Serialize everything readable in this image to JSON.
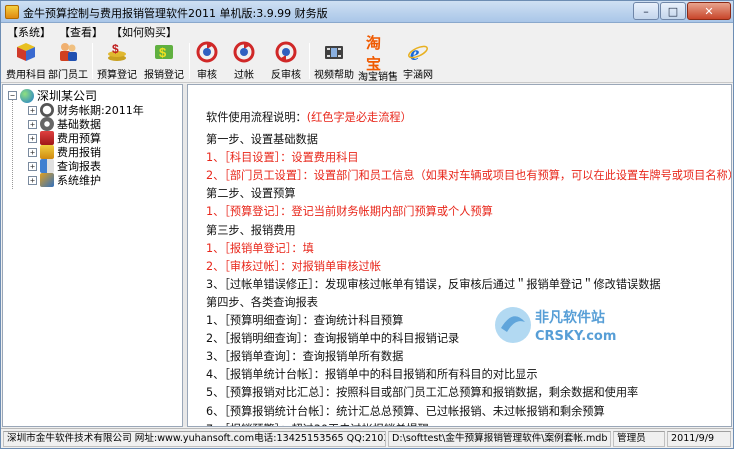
{
  "window": {
    "title": "金牛预算控制与费用报销管理软件2011 单机版:3.9.99 财务版",
    "min_glyph": "–",
    "max_glyph": "□",
    "close_glyph": "✕"
  },
  "menu": [
    "【系统】",
    "【查看】",
    "【如何购买】"
  ],
  "toolbar": [
    {
      "label": "费用科目",
      "icon": "cube-icon"
    },
    {
      "label": "部门员工",
      "icon": "people-icon"
    },
    {
      "label": "预算登记",
      "icon": "money-icon"
    },
    {
      "label": "报销登记",
      "icon": "dollar-icon"
    },
    {
      "label": "审核",
      "icon": "review-icon"
    },
    {
      "label": "过帐",
      "icon": "post-icon"
    },
    {
      "label": "反审核",
      "icon": "unreview-icon"
    },
    {
      "label": "视频帮助",
      "icon": "video-icon"
    },
    {
      "label": "淘宝销售",
      "icon": "taobao-icon"
    },
    {
      "label": "宇涵网",
      "icon": "ie-icon"
    }
  ],
  "taobao_text": "淘宝",
  "tree": {
    "root": "深圳某公司",
    "children": [
      {
        "label": "财务帐期:2011年",
        "expand": "+"
      },
      {
        "label": "基础数据",
        "expand": "+"
      },
      {
        "label": "费用预算",
        "expand": "+"
      },
      {
        "label": "费用报销",
        "expand": "+"
      },
      {
        "label": "查询报表",
        "expand": "+"
      },
      {
        "label": "系统维护",
        "expand": "+"
      }
    ],
    "root_expand": "−"
  },
  "content": {
    "intro_label": "软件使用流程说明：",
    "intro_note": "(红色字是必走流程）",
    "lines": [
      {
        "text": "第一步、设置基础数据",
        "color": "black"
      },
      {
        "text": "1、［科目设置］：设置费用科目",
        "color": "red"
      },
      {
        "text": "2、［部门员工设置］：设置部门和员工信息（如果对车辆或项目也有预算，可以在此设置车牌号或项目名称）",
        "color": "red"
      },
      {
        "text": "第二步、设置预算",
        "color": "black"
      },
      {
        "text": "1、［预算登记］：登记当前财务帐期内部门预算或个人预算",
        "color": "red"
      },
      {
        "text": "第三步、报销费用",
        "color": "black"
      },
      {
        "text": "1、［报销单登记］：填",
        "color": "red"
      },
      {
        "text": "2、［审核过帐］：对报销单审核过帐",
        "color": "red"
      },
      {
        "text": "3、［过帐单错误修正］：发现审核过帐单有错误，反审核后通过＂报销单登记＂修改错误数据",
        "color": "black"
      },
      {
        "text": "第四步、各类查询报表",
        "color": "black"
      },
      {
        "text": "1、［预算明细查询］：查询统计科目预算",
        "color": "black"
      },
      {
        "text": "2、［报销明细查询］：查询报销单中的科目报销记录",
        "color": "black"
      },
      {
        "text": "3、［报销单查询］：查询报销单所有数据",
        "color": "black"
      },
      {
        "text": "4、［报销单统计台帐］：报销单中的科目报销和所有科目的对比显示",
        "color": "black"
      },
      {
        "text": "5、［预算报销对比汇总］：按照科目或部门员工汇总预算和报销数据，剩余数据和使用率",
        "color": "black"
      },
      {
        "text": "6、［预算报销统计台帐］：统计汇总总预算、已过帐报销、未过帐报销和剩余预算",
        "color": "black"
      },
      {
        "text": "7、［报销预警］：超过30天未过帐报销单提醒",
        "color": "black"
      }
    ]
  },
  "watermark": {
    "line1": "非凡软件站",
    "line2": "CRSKY.com"
  },
  "status": {
    "company": "深圳市金牛软件技术有限公司 网址:www.yuhansoft.com电话:13425153565 QQ:21035391",
    "path": "D:\\softtest\\金牛预算报销管理软件\\案例套帐.mdb",
    "user": "管理员",
    "date": "2011/9/9"
  },
  "colors": {
    "red": "#e8261a",
    "titlebar": "#a9c6e8"
  }
}
